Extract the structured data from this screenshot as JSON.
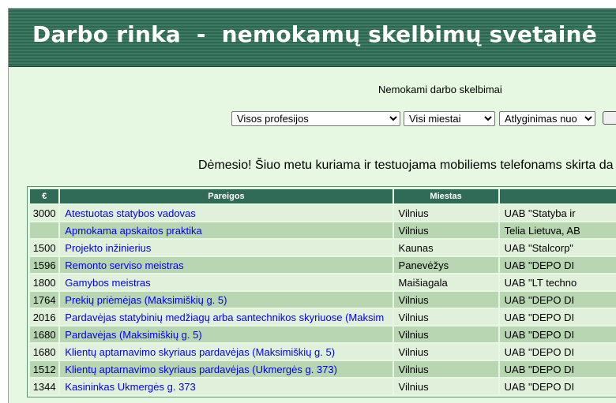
{
  "header": {
    "title": "Darbo rinka  -  nemokamų skelbimų svetainė"
  },
  "subtitle": "Nemokami darbo skelbimai",
  "filters": {
    "profession": "Visos profesijos",
    "city": "Visi miestai",
    "salary": "Atlyginimas nuo"
  },
  "notice": "Dėmesio! Šiuo metu kuriama ir testuojama mobiliems telefonams skirta da",
  "table": {
    "headers": {
      "salary": "€",
      "position": "Pareigos",
      "city": "Miestas",
      "company": ""
    },
    "rows": [
      {
        "salary": "3000",
        "position": "Atestuotas statybos vadovas",
        "city": "Vilnius",
        "company": "UAB \"Statyba ir"
      },
      {
        "salary": "",
        "position": "Apmokama apskaitos praktika",
        "city": "Vilnius",
        "company": "Telia Lietuva, AB"
      },
      {
        "salary": "1500",
        "position": "Projekto inžinierius",
        "city": "Kaunas",
        "company": "UAB \"Stalcorp\""
      },
      {
        "salary": "1596",
        "position": "Remonto serviso meistras",
        "city": "Panevėžys",
        "company": "UAB \"DEPO DI"
      },
      {
        "salary": "1800",
        "position": "Gamybos meistras",
        "city": "Maišiagala",
        "company": "UAB \"LT techno"
      },
      {
        "salary": "1764",
        "position": "Prekių priėmėjas (Maksimiškių g. 5)",
        "city": "Vilnius",
        "company": "UAB \"DEPO DI"
      },
      {
        "salary": "2016",
        "position": "Pardavėjas statybinių medžiagų arba santechnikos skyriuose (Maksim",
        "city": "Vilnius",
        "company": "UAB \"DEPO DI"
      },
      {
        "salary": "1680",
        "position": "Pardavėjas (Maksimiškių g. 5)",
        "city": "Vilnius",
        "company": "UAB \"DEPO DI"
      },
      {
        "salary": "1680",
        "position": "Klientų aptarnavimo skyriaus pardavėjas (Maksimiškių g. 5)",
        "city": "Vilnius",
        "company": "UAB \"DEPO DI"
      },
      {
        "salary": "1512",
        "position": "Klientų aptarnavimo skyriaus pardavėjas (Ukmergės g. 373)",
        "city": "Vilnius",
        "company": "UAB \"DEPO DI"
      },
      {
        "salary": "1344",
        "position": "Kasininkas Ukmergės g. 373",
        "city": "Vilnius",
        "company": "UAB \"DEPO DI"
      }
    ]
  }
}
